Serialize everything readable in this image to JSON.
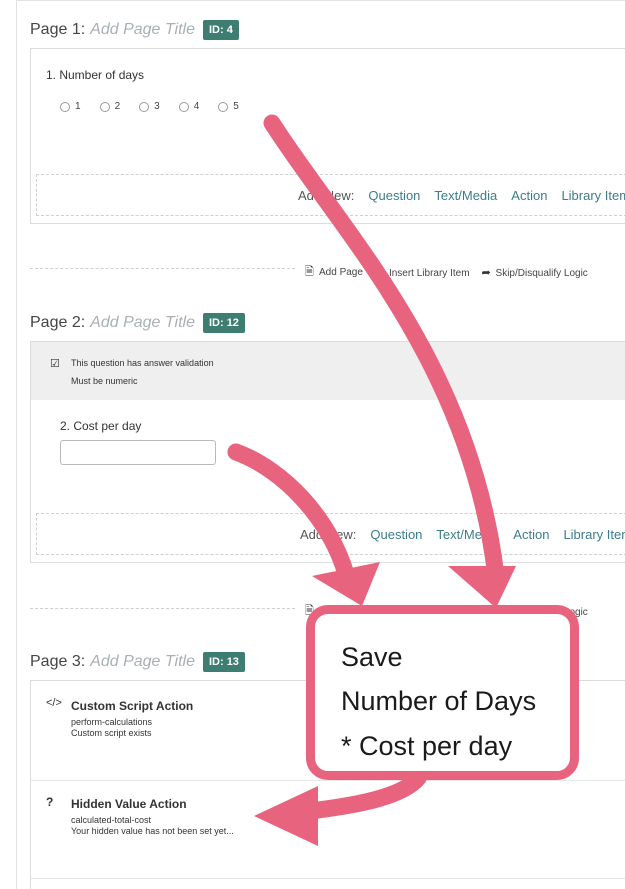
{
  "pages": [
    {
      "prefix": "Page 1:",
      "title_placeholder": "Add Page Title",
      "id_badge": "ID: 4"
    },
    {
      "prefix": "Page 2:",
      "title_placeholder": "Add Page Title",
      "id_badge": "ID: 12"
    },
    {
      "prefix": "Page 3:",
      "title_placeholder": "Add Page Title",
      "id_badge": "ID: 13"
    }
  ],
  "q1": {
    "label": "1. Number of days",
    "options": [
      "1",
      "2",
      "3",
      "4",
      "5"
    ]
  },
  "q2": {
    "label": "2. Cost per day",
    "validation_title": "This question has answer validation",
    "validation_rule": "Must be numeric",
    "input_value": ""
  },
  "add_new": {
    "label": "Add New:",
    "links": [
      "Question",
      "Text/Media",
      "Action",
      "Library Item"
    ]
  },
  "toolbar": {
    "add_page": "Add Page",
    "insert_library": "Insert Library Item",
    "skip_logic": "Skip/Disqualify Logic"
  },
  "actions": [
    {
      "icon_glyph": "</>",
      "name": "Custom Script Action",
      "line1": "perform-calculations",
      "line2": "Custom script exists"
    },
    {
      "icon_glyph": "?",
      "name": "Hidden Value Action",
      "line1": "calculated-total-cost",
      "line2": "Your hidden value has not been set yet..."
    }
  ],
  "callout": {
    "lines": [
      "Save",
      "Number of Days",
      "* Cost per day"
    ]
  },
  "colors": {
    "id_badge": "#3d7d72",
    "link": "#3b7d8b",
    "annotation": "#e8637e",
    "validation_bg": "#efefef"
  }
}
